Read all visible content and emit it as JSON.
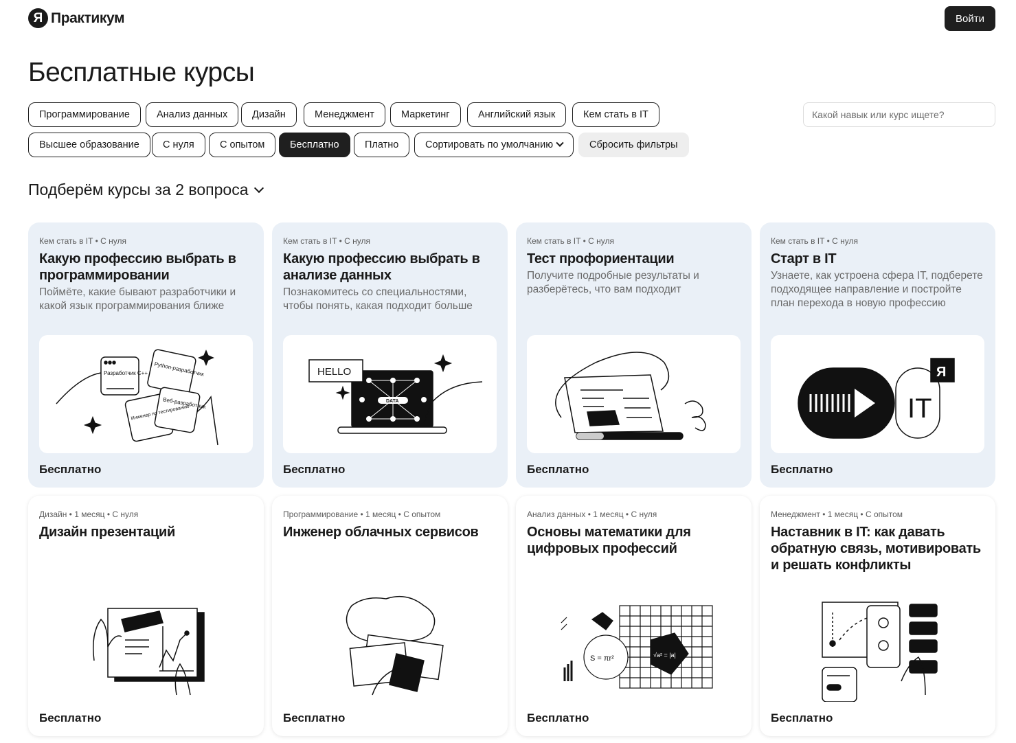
{
  "header": {
    "logo_mark": "Я",
    "logo_text": "Практикум",
    "login_label": "Войти"
  },
  "page_title": "Бесплатные курсы",
  "filters": {
    "row1": [
      "Программирование",
      "Анализ данных",
      "Дизайн",
      "Менеджмент",
      "Маркетинг",
      "Английский язык",
      "Кем стать в IT"
    ],
    "row2": [
      "Высшее образование",
      "С нуля",
      "С опытом",
      "Бесплатно",
      "Платно"
    ],
    "active": "Бесплатно",
    "sort_label": "Сортировать по умолчанию",
    "reset_label": "Сбросить фильтры"
  },
  "search": {
    "placeholder": "Какой навык или курс ищете?"
  },
  "quiz_label": "Подберём курсы за 2 вопроса",
  "cards": [
    {
      "meta": "Кем стать в IT • С нуля",
      "title": "Какую профессию выбрать в программировании",
      "desc": "Поймёте, какие бывают разработчики и какой язык программирования ближе",
      "price": "Бесплатно",
      "illus_labels": [
        "Разработчик C++",
        "Python-разработчик",
        "Инженер по тестированию",
        "Веб-разработчик"
      ]
    },
    {
      "meta": "Кем стать в IT • С нуля",
      "title": "Какую профессию выбрать в анализе данных",
      "desc": "Познакомитесь со специальностями, чтобы понять, какая подходит больше",
      "price": "Бесплатно",
      "illus_labels": [
        "HELLO",
        "DATA"
      ]
    },
    {
      "meta": "Кем стать в IT • С нуля",
      "title": "Тест профориентации",
      "desc": "Получите подробные результаты и разберётесь, что вам подходит",
      "price": "Бесплатно"
    },
    {
      "meta": "Кем стать в IT • С нуля",
      "title": "Старт в IT",
      "desc": "Узнаете, как устроена сфера IT, подберете подходящее направление и постройте план перехода в новую профессию",
      "price": "Бесплатно",
      "illus_labels": [
        "IT",
        "Я"
      ]
    },
    {
      "meta": "Дизайн • 1 месяц • С нуля",
      "title": "Дизайн презентаций",
      "price": "Бесплатно"
    },
    {
      "meta": "Программирование • 1 месяц • С опытом",
      "title": "Инженер облачных сервисов",
      "price": "Бесплатно"
    },
    {
      "meta": "Анализ данных • 1 месяц • С нуля",
      "title": "Основы математики для цифровых профессий",
      "price": "Бесплатно",
      "illus_labels": [
        "S = πr²",
        "√a² = |a|"
      ]
    },
    {
      "meta": "Менеджмент • 1 месяц • С опытом",
      "title": "Наставник в IT: как давать обратную связь, мотивировать и решать конфликты",
      "price": "Бесплатно"
    }
  ]
}
